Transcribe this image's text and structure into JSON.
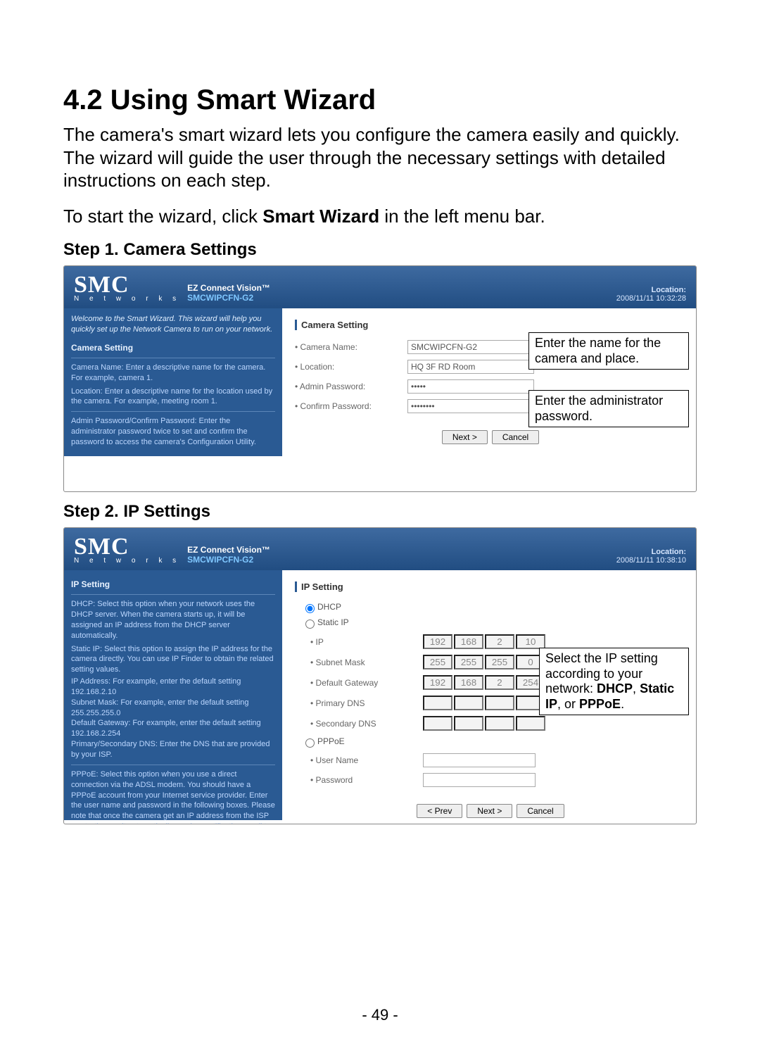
{
  "heading": "4.2  Using Smart Wizard",
  "para1": "The camera's smart wizard lets you configure the camera easily and quickly. The wizard will guide the user through the necessary settings with detailed instructions on each step.",
  "para2_pre": "To start the wizard, click ",
  "para2_bold": "Smart Wizard",
  "para2_post": " in the left menu bar.",
  "step1_title": "Step 1. Camera Settings",
  "step2_title": "Step 2. IP Settings",
  "brand": {
    "smc": "SMC",
    "networks": "N e t w o r k s",
    "line1": "EZ Connect Vision™",
    "line2": "SMCWIPCFN-G2"
  },
  "panel1": {
    "loc_label": "Location:",
    "loc_value": "2008/11/11 10:32:28",
    "side_intro": "Welcome to the Smart Wizard. This wizard will help you quickly set up the Network Camera to run on your network.",
    "side_sec": "Camera Setting",
    "side_t1": "Camera Name: Enter a descriptive name for the camera. For example, camera 1.",
    "side_t2": "Location: Enter a descriptive name for the location used by the camera. For example, meeting room 1.",
    "side_t3": "Admin Password/Confirm Password: Enter the administrator password twice to set and confirm the password to access the camera's Configuration Utility.",
    "main_title": "Camera Setting",
    "f_camera_label": "Camera Name:",
    "f_camera_value": "SMCWIPCFN-G2",
    "f_location_label": "Location:",
    "f_location_value": "HQ 3F RD Room",
    "f_admin_label": "Admin Password:",
    "f_admin_value": "•••••",
    "f_confirm_label": "Confirm Password:",
    "f_confirm_value": "••••••••",
    "btn_next": "Next >",
    "btn_cancel": "Cancel",
    "callout1": "Enter the name for the camera and place.",
    "callout2": "Enter the administrator password."
  },
  "panel2": {
    "loc_label": "Location:",
    "loc_value": "2008/11/11 10:38:10",
    "side_sec": "IP Setting",
    "side_t1": "DHCP: Select this option when your network uses the DHCP server. When the camera starts up, it will be assigned an IP address from the DHCP server automatically.",
    "side_t2": "Static IP: Select this option to assign the IP address for the camera directly. You can use IP Finder to obtain the related setting values.",
    "side_t2a": "IP Address: For example, enter the default setting 192.168.2.10",
    "side_t2b": "Subnet Mask: For example, enter the default setting 255.255.255.0",
    "side_t2c": "Default Gateway: For example, enter the default setting 192.168.2.254",
    "side_t2d": "Primary/Secondary DNS: Enter the DNS that are provided by your ISP.",
    "side_t3": "PPPoE: Select this option when you use a direct connection via the ADSL modem. You should have a PPPoE account from your Internet service provider. Enter the user name and password in the following boxes. Please note that once the camera get an IP address from the ISP as starting up, it automatically sends a notification email to you. Therefore, when you select PPPoE as your connecting type, you have to set up the email configuration in next step.",
    "main_title": "IP Setting",
    "opt_dhcp": "DHCP",
    "opt_static": "Static IP",
    "opt_pppoe": "PPPoE",
    "lbl_ip": "IP",
    "lbl_mask": "Subnet Mask",
    "lbl_gw": "Default Gateway",
    "lbl_pdns": "Primary DNS",
    "lbl_sdns": "Secondary DNS",
    "lbl_user": "User Name",
    "lbl_pass": "Password",
    "ip": [
      "192",
      "168",
      "2",
      "10"
    ],
    "mask": [
      "255",
      "255",
      "255",
      "0"
    ],
    "gw": [
      "192",
      "168",
      "2",
      "254"
    ],
    "btn_prev": "< Prev",
    "btn_next": "Next >",
    "btn_cancel": "Cancel",
    "callout_pre": "Select the IP setting according to your network: ",
    "callout_b1": "DHCP",
    "callout_mid1": ", ",
    "callout_b2": "Static IP",
    "callout_mid2": ", or ",
    "callout_b3": "PPPoE",
    "callout_post": "."
  },
  "page_number": "- 49 -"
}
